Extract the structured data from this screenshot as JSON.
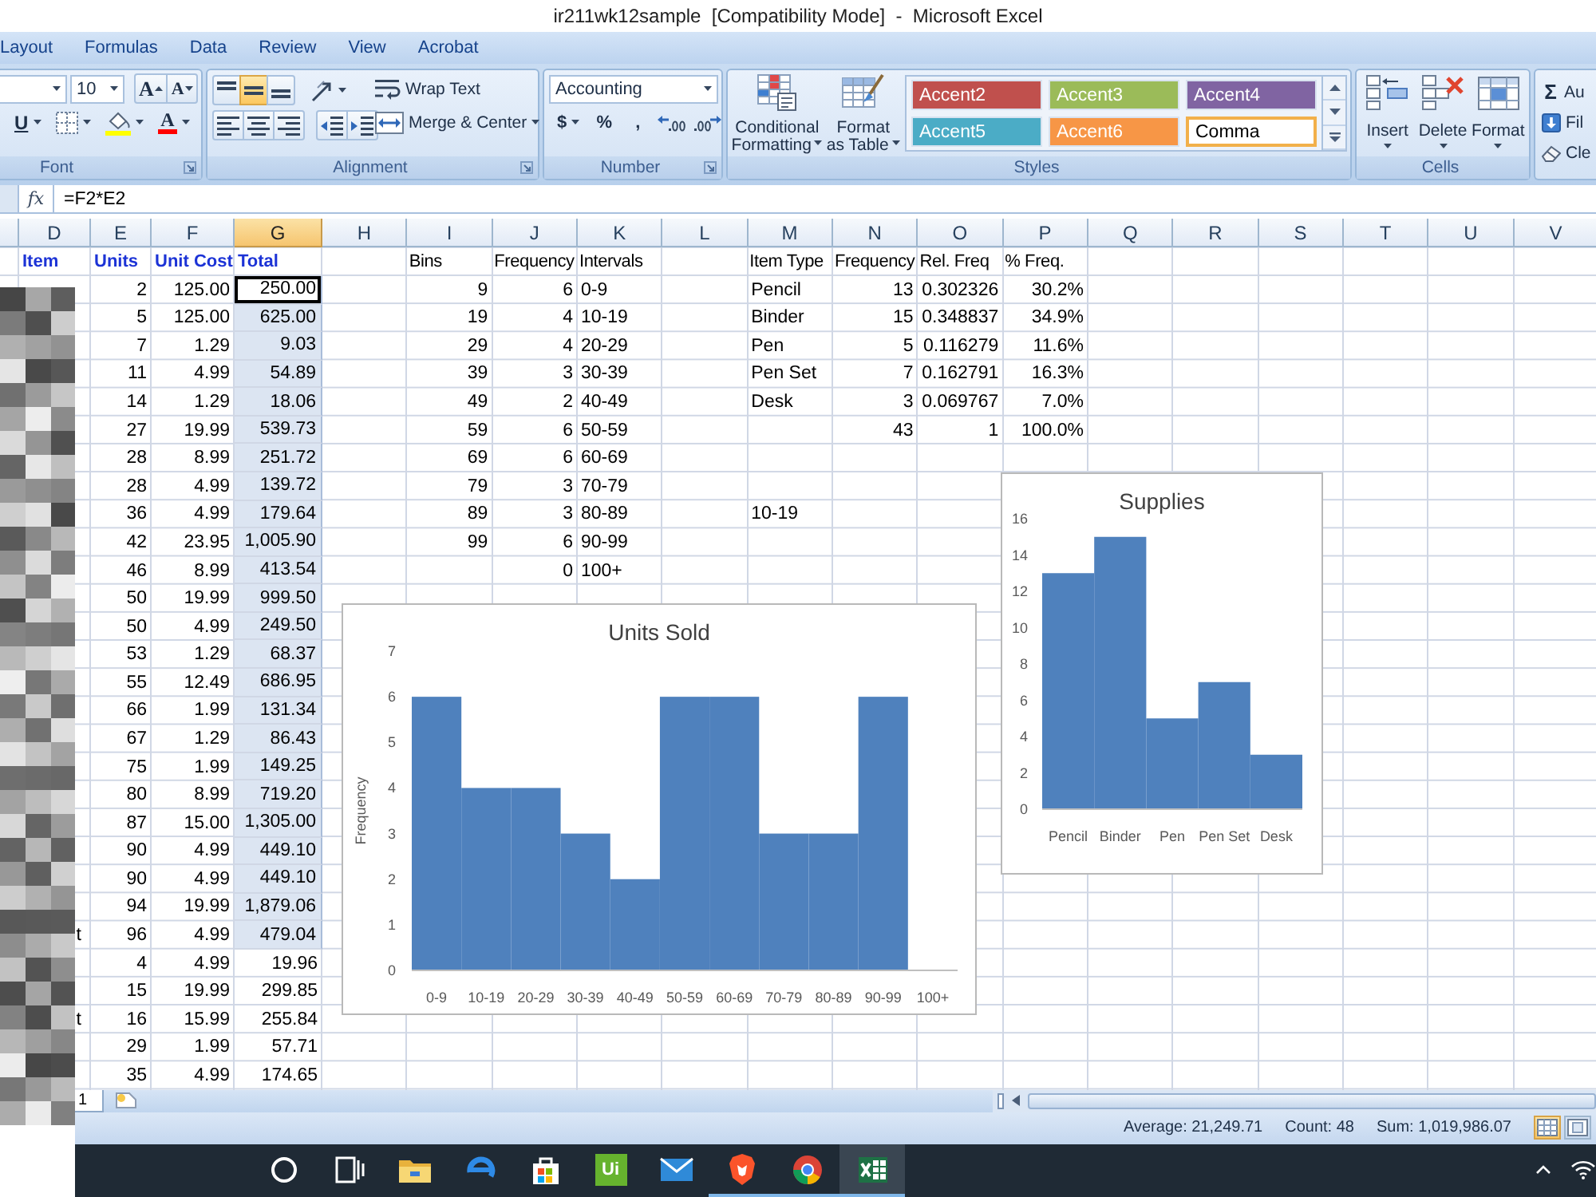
{
  "window": {
    "title": "ir211wk12sample  [Compatibility Mode]  -  Microsoft Excel"
  },
  "ribbon_tabs": [
    {
      "label": "Layout",
      "selected": false
    },
    {
      "label": "Formulas",
      "selected": false
    },
    {
      "label": "Data",
      "selected": false
    },
    {
      "label": "Review",
      "selected": false
    },
    {
      "label": "View",
      "selected": false
    },
    {
      "label": "Acrobat",
      "selected": false
    }
  ],
  "font_group": {
    "label": "Font",
    "font_size": "10",
    "grow_font": "A",
    "shrink_font": "A",
    "underline": "U",
    "font_color": "A"
  },
  "alignment_group": {
    "label": "Alignment",
    "vertical": [
      {
        "kind": "top",
        "selected": false
      },
      {
        "kind": "middle",
        "selected": true
      },
      {
        "kind": "bottom",
        "selected": false
      }
    ],
    "horizontal": [
      {
        "kind": "left",
        "selected": false
      },
      {
        "kind": "center",
        "selected": false
      },
      {
        "kind": "right",
        "selected": false
      }
    ],
    "wrap_text": "Wrap Text",
    "merge_center": "Merge & Center"
  },
  "number_group": {
    "label": "Number",
    "format": "Accounting",
    "currency": "$",
    "percent": "%",
    "comma": ","
  },
  "styles_group": {
    "label": "Styles",
    "conditional_formatting": [
      "Conditional",
      "Formatting"
    ],
    "format_as_table": [
      "Format",
      "as Table"
    ],
    "cell_styles": [
      {
        "label": "Accent2",
        "color": "#c0504d",
        "selected": false
      },
      {
        "label": "Accent3",
        "color": "#9bbb59",
        "selected": false
      },
      {
        "label": "Accent4",
        "color": "#8064a2",
        "selected": false
      },
      {
        "label": "Accent5",
        "color": "#4bacc6",
        "selected": false
      },
      {
        "label": "Accent6",
        "color": "#f79646",
        "selected": false
      },
      {
        "label": "Comma",
        "color": "#ffffff",
        "selected": true
      }
    ]
  },
  "cells_group": {
    "label": "Cells",
    "buttons": [
      {
        "kind": "insert",
        "label": "Insert"
      },
      {
        "kind": "delete",
        "label": "Delete"
      },
      {
        "kind": "format",
        "label": "Format"
      }
    ]
  },
  "editing_group": {
    "buttons": [
      {
        "kind": "autosum",
        "icon": "Σ",
        "label": "Au"
      },
      {
        "kind": "fill",
        "label": "Fil"
      },
      {
        "kind": "clear",
        "label": "Cle"
      }
    ]
  },
  "formula_bar": {
    "function_button": "fx",
    "formula": "=F2*E2"
  },
  "columns": [
    {
      "label": "D",
      "selected": false
    },
    {
      "label": "E",
      "selected": false
    },
    {
      "label": "F",
      "selected": false
    },
    {
      "label": "G",
      "selected": true
    },
    {
      "label": "H",
      "selected": false
    },
    {
      "label": "I",
      "selected": false
    },
    {
      "label": "J",
      "selected": false
    },
    {
      "label": "K",
      "selected": false
    },
    {
      "label": "L",
      "selected": false
    },
    {
      "label": "M",
      "selected": false
    },
    {
      "label": "N",
      "selected": false
    },
    {
      "label": "O",
      "selected": false
    },
    {
      "label": "P",
      "selected": false
    },
    {
      "label": "Q",
      "selected": false
    },
    {
      "label": "R",
      "selected": false
    },
    {
      "label": "S",
      "selected": false
    },
    {
      "label": "T",
      "selected": false
    },
    {
      "label": "U",
      "selected": false
    },
    {
      "label": "V",
      "selected": false
    }
  ],
  "sales_table": {
    "headers": [
      "Item",
      "Units",
      "Unit Cost",
      "Total"
    ],
    "rows": [
      {
        "units": "2",
        "unit_cost": "125.00",
        "total": "250.00",
        "selected": true,
        "active": true
      },
      {
        "units": "5",
        "unit_cost": "125.00",
        "total": "625.00",
        "selected": true,
        "active": false
      },
      {
        "units": "7",
        "unit_cost": "1.29",
        "total": "9.03",
        "selected": true,
        "active": false
      },
      {
        "units": "11",
        "unit_cost": "4.99",
        "total": "54.89",
        "selected": true,
        "active": false
      },
      {
        "units": "14",
        "unit_cost": "1.29",
        "total": "18.06",
        "selected": true,
        "active": false
      },
      {
        "units": "27",
        "unit_cost": "19.99",
        "total": "539.73",
        "selected": true,
        "active": false
      },
      {
        "units": "28",
        "unit_cost": "8.99",
        "total": "251.72",
        "selected": true,
        "active": false
      },
      {
        "units": "28",
        "unit_cost": "4.99",
        "total": "139.72",
        "selected": true,
        "active": false
      },
      {
        "units": "36",
        "unit_cost": "4.99",
        "total": "179.64",
        "selected": true,
        "active": false
      },
      {
        "units": "42",
        "unit_cost": "23.95",
        "total": "1,005.90",
        "selected": true,
        "active": false
      },
      {
        "units": "46",
        "unit_cost": "8.99",
        "total": "413.54",
        "selected": true,
        "active": false
      },
      {
        "units": "50",
        "unit_cost": "19.99",
        "total": "999.50",
        "selected": true,
        "active": false
      },
      {
        "units": "50",
        "unit_cost": "4.99",
        "total": "249.50",
        "selected": true,
        "active": false
      },
      {
        "units": "53",
        "unit_cost": "1.29",
        "total": "68.37",
        "selected": true,
        "active": false
      },
      {
        "units": "55",
        "unit_cost": "12.49",
        "total": "686.95",
        "selected": true,
        "active": false
      },
      {
        "units": "66",
        "unit_cost": "1.99",
        "total": "131.34",
        "selected": true,
        "active": false
      },
      {
        "units": "67",
        "unit_cost": "1.29",
        "total": "86.43",
        "selected": true,
        "active": false
      },
      {
        "units": "75",
        "unit_cost": "1.99",
        "total": "149.25",
        "selected": true,
        "active": false
      },
      {
        "units": "80",
        "unit_cost": "8.99",
        "total": "719.20",
        "selected": true,
        "active": false
      },
      {
        "units": "87",
        "unit_cost": "15.00",
        "total": "1,305.00",
        "selected": true,
        "active": false
      },
      {
        "units": "90",
        "unit_cost": "4.99",
        "total": "449.10",
        "selected": true,
        "active": false
      },
      {
        "units": "90",
        "unit_cost": "4.99",
        "total": "449.10",
        "selected": true,
        "active": false
      },
      {
        "units": "94",
        "unit_cost": "19.99",
        "total": "1,879.06",
        "selected": true,
        "active": false
      },
      {
        "item": "t",
        "units": "96",
        "unit_cost": "4.99",
        "total": "479.04",
        "selected": true,
        "active": false
      },
      {
        "units": "4",
        "unit_cost": "4.99",
        "total": "19.96",
        "selected": false,
        "active": false
      },
      {
        "units": "15",
        "unit_cost": "19.99",
        "total": "299.85",
        "selected": false,
        "active": false
      },
      {
        "item": "t",
        "units": "16",
        "unit_cost": "15.99",
        "total": "255.84",
        "selected": false,
        "active": false
      },
      {
        "units": "29",
        "unit_cost": "1.99",
        "total": "57.71",
        "selected": false,
        "active": false
      },
      {
        "units": "35",
        "unit_cost": "4.99",
        "total": "174.65",
        "selected": false,
        "active": false
      }
    ]
  },
  "frequency_table": {
    "headers": [
      "Bins",
      "Frequency",
      "Intervals"
    ],
    "rows": [
      {
        "bin": "9",
        "frequency": "6",
        "interval": "0-9"
      },
      {
        "bin": "19",
        "frequency": "4",
        "interval": "10-19"
      },
      {
        "bin": "29",
        "frequency": "4",
        "interval": "20-29"
      },
      {
        "bin": "39",
        "frequency": "3",
        "interval": "30-39"
      },
      {
        "bin": "49",
        "frequency": "2",
        "interval": "40-49"
      },
      {
        "bin": "59",
        "frequency": "6",
        "interval": "50-59"
      },
      {
        "bin": "69",
        "frequency": "6",
        "interval": "60-69"
      },
      {
        "bin": "79",
        "frequency": "3",
        "interval": "70-79"
      },
      {
        "bin": "89",
        "frequency": "3",
        "interval": "80-89"
      },
      {
        "bin": "99",
        "frequency": "6",
        "interval": "90-99"
      },
      {
        "frequency": "0",
        "interval": "100+"
      }
    ]
  },
  "item_type_table": {
    "headers": [
      "Item Type",
      "Frequency",
      "Rel. Freq",
      "% Freq."
    ],
    "rows": [
      {
        "item_type": "Pencil",
        "frequency": "13",
        "rel_freq": "0.302326",
        "percent": "30.2%"
      },
      {
        "item_type": "Binder",
        "frequency": "15",
        "rel_freq": "0.348837",
        "percent": "34.9%"
      },
      {
        "item_type": "Pen",
        "frequency": "5",
        "rel_freq": "0.116279",
        "percent": "11.6%"
      },
      {
        "item_type": "Pen Set",
        "frequency": "7",
        "rel_freq": "0.162791",
        "percent": "16.3%"
      },
      {
        "item_type": "Desk",
        "frequency": "3",
        "rel_freq": "0.069767",
        "percent": "7.0%"
      }
    ],
    "total": {
      "frequency": "43",
      "rel_freq": "1",
      "percent": "100.0%"
    }
  },
  "stray_cell": "10-19",
  "charts": [
    {
      "chart_data": {
        "type": "bar",
        "title": "Supplies",
        "categories": [
          "Pencil",
          "Binder",
          "Pen",
          "Pen Set",
          "Desk"
        ],
        "values": [
          13,
          15,
          5,
          7,
          3
        ],
        "ylim": [
          0,
          16
        ],
        "yticks": [
          0,
          2,
          4,
          6,
          8,
          10,
          12,
          14,
          16
        ]
      }
    },
    {
      "chart_data": {
        "type": "bar",
        "title": "Units Sold",
        "ylabel": "Frequency",
        "categories": [
          "0-9",
          "10-19",
          "20-29",
          "30-39",
          "40-49",
          "50-59",
          "60-69",
          "70-79",
          "80-89",
          "90-99",
          "100+"
        ],
        "values": [
          6,
          4,
          4,
          3,
          2,
          6,
          6,
          3,
          3,
          6,
          0
        ],
        "ylim": [
          0,
          7
        ],
        "yticks": [
          0,
          1,
          2,
          3,
          4,
          5,
          6,
          7
        ]
      }
    }
  ],
  "sheet_tabs": [
    {
      "label": "1",
      "selected": true
    }
  ],
  "status_bar": {
    "average": "Average: 21,249.71",
    "count": "Count: 48",
    "sum": "Sum: 1,019,986.07"
  },
  "view_buttons": [
    {
      "kind": "normal",
      "selected": true
    },
    {
      "kind": "page_layout",
      "selected": false
    }
  ],
  "taskbar": {
    "items": [
      {
        "kind": "cortana",
        "running": false,
        "active": false
      },
      {
        "kind": "task_view",
        "running": false,
        "active": false
      },
      {
        "kind": "explorer",
        "running": false,
        "active": false
      },
      {
        "kind": "edge",
        "running": false,
        "active": false
      },
      {
        "kind": "store",
        "running": false,
        "active": false
      },
      {
        "kind": "uipath",
        "label": "Ui",
        "running": false,
        "active": false
      },
      {
        "kind": "mail",
        "running": false,
        "active": false
      },
      {
        "kind": "brave",
        "running": true,
        "active": false
      },
      {
        "kind": "chrome",
        "running": true,
        "active": false
      },
      {
        "kind": "excel",
        "running": true,
        "active": true
      }
    ]
  }
}
